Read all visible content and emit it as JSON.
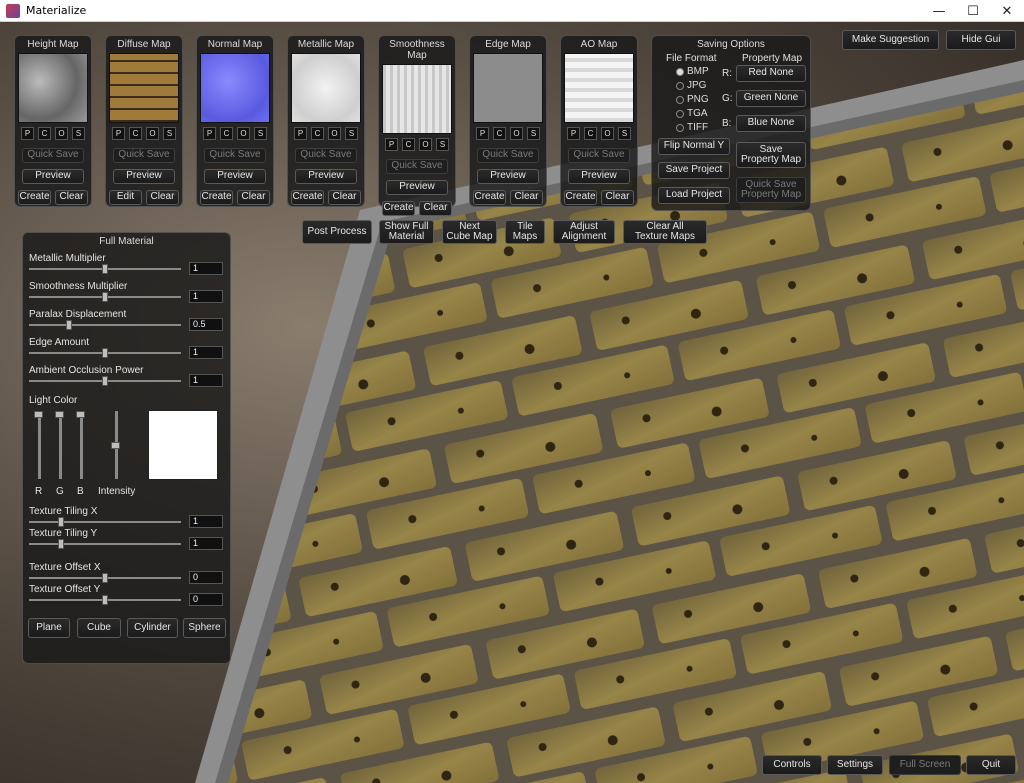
{
  "window": {
    "title": "Materialize",
    "minimize": "—",
    "maximize": "☐",
    "close": "✕"
  },
  "top_right": {
    "make_suggestion": "Make Suggestion",
    "hide_gui": "Hide Gui"
  },
  "maps": [
    {
      "title": "Height Map",
      "quick_save": "Quick Save",
      "preview": "Preview",
      "left": "Create",
      "right": "Clear",
      "quick_save_disabled": true
    },
    {
      "title": "Diffuse Map",
      "quick_save": "Quick Save",
      "preview": "Preview",
      "left": "Edit",
      "right": "Clear",
      "quick_save_disabled": true
    },
    {
      "title": "Normal Map",
      "quick_save": "Quick Save",
      "preview": "Preview",
      "left": "Create",
      "right": "Clear",
      "quick_save_disabled": true
    },
    {
      "title": "Metallic Map",
      "quick_save": "Quick Save",
      "preview": "Preview",
      "left": "Create",
      "right": "Clear",
      "quick_save_disabled": true
    },
    {
      "title": "Smoothness Map",
      "quick_save": "Quick Save",
      "preview": "Preview",
      "left": "Create",
      "right": "Clear",
      "quick_save_disabled": true
    },
    {
      "title": "Edge Map",
      "quick_save": "Quick Save",
      "preview": "Preview",
      "left": "Create",
      "right": "Clear",
      "quick_save_disabled": true
    },
    {
      "title": "AO Map",
      "quick_save": "Quick Save",
      "preview": "Preview",
      "left": "Create",
      "right": "Clear",
      "quick_save_disabled": true
    }
  ],
  "psos": [
    "P",
    "C",
    "O",
    "S"
  ],
  "saving": {
    "title": "Saving Options",
    "file_format_label": "File Format",
    "property_map_label": "Property Map",
    "formats": [
      "BMP",
      "JPG",
      "PNG",
      "TGA",
      "TIFF"
    ],
    "selected_format": "BMP",
    "channels": [
      {
        "letter": "R:",
        "value": "Red None"
      },
      {
        "letter": "G:",
        "value": "Green None"
      },
      {
        "letter": "B:",
        "value": "Blue None"
      }
    ],
    "flip_normal_y": "Flip Normal Y",
    "save_project": "Save Project",
    "load_project": "Load Project",
    "save_property_map": "Save\nProperty Map",
    "quick_save_property_map": "Quick Save\nProperty Map"
  },
  "toolbar": {
    "post_process": "Post Process",
    "show_full_material": "Show Full\nMaterial",
    "next_cube_map": "Next\nCube Map",
    "tile_maps": "Tile\nMaps",
    "adjust_alignment": "Adjust\nAlignment",
    "clear_all": "Clear All\nTexture Maps"
  },
  "full_material": {
    "title": "Full Material",
    "sliders": [
      {
        "label": "Metallic Multiplier",
        "value": "1",
        "level": 0.5
      },
      {
        "label": "Smoothness Multiplier",
        "value": "1",
        "level": 0.5
      },
      {
        "label": "Paralax Displacement",
        "value": "0.5",
        "level": 0.25
      },
      {
        "label": "Edge Amount",
        "value": "1",
        "level": 0.5
      },
      {
        "label": "Ambient Occlusion Power",
        "value": "1",
        "level": 0.5
      }
    ],
    "light_color_label": "Light Color",
    "light_channels": [
      "R",
      "G",
      "B",
      "Intensity"
    ],
    "light_levels": [
      1,
      1,
      1,
      0.5
    ],
    "light_color": "#ffffff",
    "tiling": [
      {
        "label": "Texture Tiling X",
        "value": "1",
        "level": 0.2
      },
      {
        "label": "Texture Tiling Y",
        "value": "1",
        "level": 0.2
      }
    ],
    "offset": [
      {
        "label": "Texture Offset X",
        "value": "0",
        "level": 0.5
      },
      {
        "label": "Texture Offset Y",
        "value": "0",
        "level": 0.5
      }
    ],
    "shapes": [
      "Plane",
      "Cube",
      "Cylinder",
      "Sphere"
    ]
  },
  "bottom": {
    "controls": "Controls",
    "settings": "Settings",
    "full_screen": "Full Screen",
    "quit": "Quit"
  }
}
